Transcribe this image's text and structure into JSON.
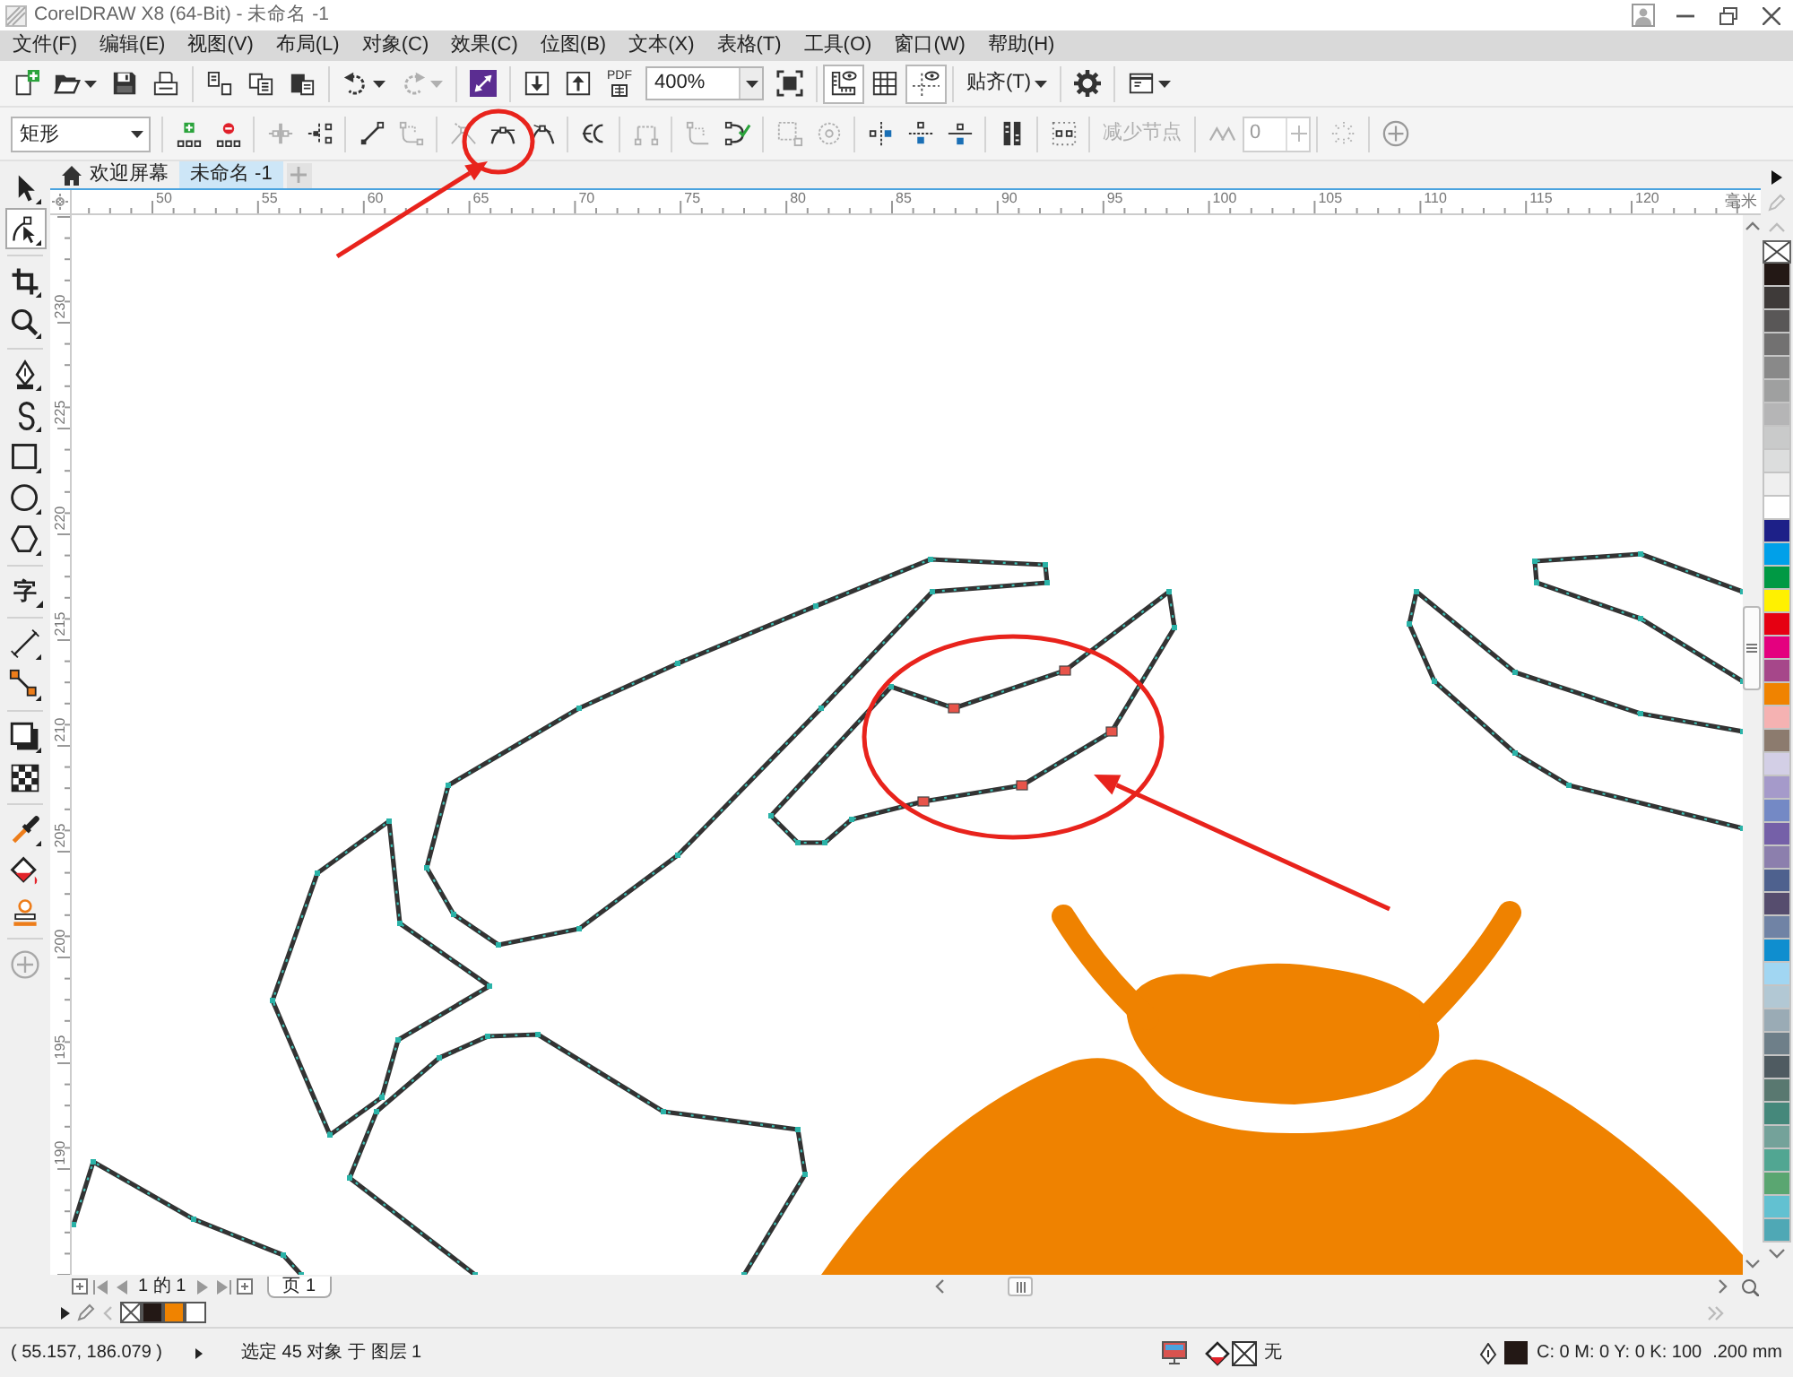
{
  "window": {
    "title": "CorelDRAW X8 (64-Bit) - 未命名 -1"
  },
  "menu": [
    "文件(F)",
    "编辑(E)",
    "视图(V)",
    "布局(L)",
    "对象(C)",
    "效果(C)",
    "位图(B)",
    "文本(X)",
    "表格(T)",
    "工具(O)",
    "窗口(W)",
    "帮助(H)"
  ],
  "standard_toolbar": {
    "buttons": [
      {
        "disabled": false
      },
      {
        "disabled": false
      },
      {
        "disabled": false
      },
      {
        "disabled": false
      },
      {
        "disabled": false
      },
      {
        "disabled": false
      },
      {
        "disabled": false
      },
      {
        "disabled": false
      },
      {
        "disabled": true
      },
      {
        "disabled": false
      },
      {
        "disabled": false
      },
      {
        "disabled": false
      },
      {
        "disabled": false
      },
      {
        "disabled": false
      },
      {
        "disabled": false
      }
    ],
    "pdf_label": "PDF",
    "zoom_level": "400%",
    "view_toggles": [
      {
        "on": true
      },
      {
        "on": false
      },
      {
        "on": true
      }
    ],
    "snap_label": "贴齐(T)"
  },
  "property_bar": {
    "object_type": "矩形",
    "buttons": [
      {
        "disabled": false
      },
      {
        "disabled": false
      },
      {
        "disabled": true
      },
      {
        "disabled": false
      },
      {
        "disabled": false
      },
      {
        "disabled": true
      },
      {
        "disabled": true
      },
      {
        "disabled": false
      },
      {
        "disabled": false
      },
      {
        "disabled": false
      },
      {
        "disabled": true
      },
      {
        "disabled": true
      },
      {
        "disabled": false
      },
      {
        "disabled": true
      },
      {
        "disabled": true
      },
      {
        "disabled": false
      },
      {
        "disabled": false
      },
      {
        "disabled": false
      },
      {
        "disabled": false
      },
      {
        "disabled": false
      },
      {
        "disabled": true
      },
      {
        "disabled": true
      },
      {
        "disabled": false
      }
    ],
    "reduce_nodes": {
      "label": "减少节点",
      "disabled": true
    },
    "smoothness": {
      "value": "0",
      "disabled": true
    }
  },
  "toolbox": [
    {
      "kind": "icon",
      "selected": false
    },
    {
      "kind": "icon",
      "selected": true
    },
    {
      "kind": "icon",
      "selected": false
    },
    {
      "kind": "icon",
      "selected": false
    },
    {
      "kind": "icon",
      "selected": false
    },
    {
      "kind": "icon",
      "selected": false
    },
    {
      "kind": "icon",
      "selected": false
    },
    {
      "kind": "icon",
      "selected": false
    },
    {
      "kind": "icon",
      "selected": false
    },
    {
      "kind": "glyph",
      "glyph": "字",
      "selected": false
    },
    {
      "kind": "icon",
      "selected": false
    },
    {
      "kind": "icon",
      "selected": false
    },
    {
      "kind": "icon",
      "selected": false
    },
    {
      "kind": "icon",
      "selected": false
    },
    {
      "kind": "icon",
      "selected": false
    },
    {
      "kind": "icon",
      "selected": false
    },
    {
      "kind": "icon",
      "selected": false
    },
    {
      "kind": "icon",
      "selected": false
    }
  ],
  "document_tabs": [
    {
      "label": "欢迎屏幕",
      "selected": false
    },
    {
      "label": "未命名 -1",
      "selected": true
    }
  ],
  "ruler_top": {
    "labels": [
      "50",
      "55",
      "60",
      "65",
      "70",
      "75",
      "80",
      "85",
      "90",
      "95",
      "100",
      "105",
      "110",
      "115",
      "120"
    ],
    "unit": "毫米"
  },
  "ruler_left": {
    "labels": [
      "230",
      "225",
      "220",
      "215",
      "210",
      "205",
      "200",
      "195",
      "190"
    ]
  },
  "page_navigator": {
    "page_count": "1 的 1",
    "page_tabs": [
      {
        "label": "页 1",
        "selected": true
      }
    ]
  },
  "palette": {
    "colors": [
      {
        "color": "#231815"
      },
      {
        "color": "#3e3a39"
      },
      {
        "color": "#595757"
      },
      {
        "color": "#727171"
      },
      {
        "color": "#898989"
      },
      {
        "color": "#9fa0a0"
      },
      {
        "color": "#b5b5b6"
      },
      {
        "color": "#c9caca"
      },
      {
        "color": "#dcdddd"
      },
      {
        "color": "#efefef"
      },
      {
        "color": "#ffffff"
      },
      {
        "color": "#1d2088"
      },
      {
        "color": "#00a0e9"
      },
      {
        "color": "#009944"
      },
      {
        "color": "#fff100"
      },
      {
        "color": "#e60012"
      },
      {
        "color": "#e4007f"
      },
      {
        "color": "#a6478a"
      },
      {
        "color": "#f08300"
      },
      {
        "color": "#f5b2b2"
      },
      {
        "color": "#8c7b6e"
      },
      {
        "color": "#d3cfe6"
      },
      {
        "color": "#a59aca"
      },
      {
        "color": "#7489c5"
      },
      {
        "color": "#7560a8"
      },
      {
        "color": "#8c7fad"
      },
      {
        "color": "#4e618e"
      },
      {
        "color": "#564d6e"
      },
      {
        "color": "#7083a5"
      },
      {
        "color": "#0f8ecf"
      },
      {
        "color": "#a1d6f2"
      },
      {
        "color": "#b2c8d4"
      },
      {
        "color": "#9aabb5"
      },
      {
        "color": "#6e7f89"
      },
      {
        "color": "#4f5b61"
      },
      {
        "color": "#597870"
      },
      {
        "color": "#45887b"
      },
      {
        "color": "#74a29a"
      },
      {
        "color": "#51a692"
      },
      {
        "color": "#5aa671"
      },
      {
        "color": "#62c1d1"
      },
      {
        "color": "#4fa8b5"
      }
    ]
  },
  "document_palette": {
    "colors": [
      {
        "color": "#231815"
      },
      {
        "color": "#f08300"
      },
      {
        "color": "#ffffff"
      }
    ]
  },
  "status_bar": {
    "coordinates": "( 55.157, 186.079 )",
    "selection": "选定 45 对象 于 图层 1",
    "fill": "无",
    "outline": "C: 0 M: 0 Y: 0 K: 100",
    "outline_width": ".200 mm"
  }
}
